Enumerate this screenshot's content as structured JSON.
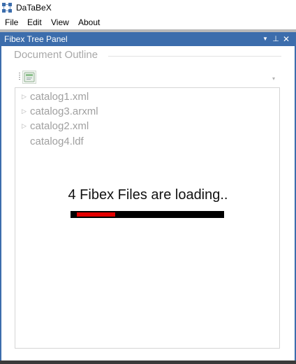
{
  "app": {
    "title": "DaTaBeX",
    "icon": "app-network-icon"
  },
  "menu": {
    "items": [
      "File",
      "Edit",
      "View",
      "About"
    ]
  },
  "panel": {
    "title": "Fibex Tree Panel",
    "header_color": "#3c6dac",
    "buttons": {
      "dropdown_icon": "▼",
      "pin_icon": "⊥",
      "close_icon": "✕"
    }
  },
  "outline": {
    "group_label": "Document Outline",
    "toolbar_button_icon": "tree-view-icon",
    "overflow_icon": "▾"
  },
  "tree": {
    "expander_icon": "▷",
    "items": [
      {
        "label": "catalog1.xml",
        "expandable": true
      },
      {
        "label": "catalog3.arxml",
        "expandable": true
      },
      {
        "label": "catalog2.xml",
        "expandable": true
      },
      {
        "label": "catalog4.ldf",
        "expandable": false
      }
    ]
  },
  "loading": {
    "message": "4 Fibex Files are loading..",
    "progress_start": 0.04,
    "progress_end": 0.29,
    "bar_color": "#000000",
    "fill_color": "#e30000"
  }
}
